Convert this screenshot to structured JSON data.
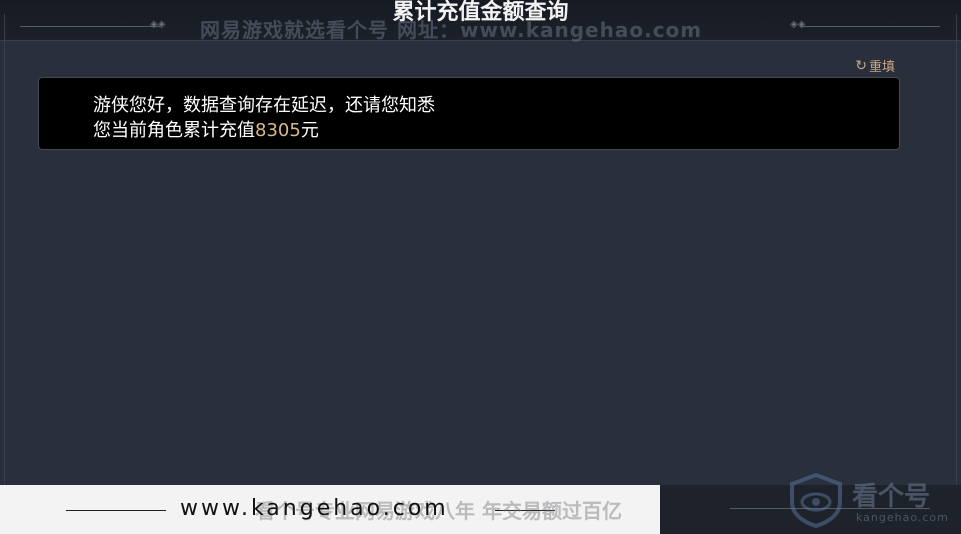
{
  "header": {
    "title": "累计充值金额查询",
    "watermark": "网易游戏就选看个号  网址：www.kangehao.com"
  },
  "toolbar": {
    "reset_label": "重填",
    "reset_icon": "refresh-icon"
  },
  "result": {
    "line1": "游侠您好，数据查询存在延迟，还请您知悉",
    "line2_prefix": "您当前角色累计充值",
    "amount": "8305",
    "line2_suffix": "元"
  },
  "footer": {
    "url": "www.kangehao.com",
    "slogan": "看个号专业网易游戏八年  年交易额过百亿",
    "logo_text": "看个号",
    "logo_sub": "kangehao.com"
  },
  "colors": {
    "accent": "#c8a784",
    "amount": "#d9b98a",
    "background": "#2a2f3c"
  }
}
